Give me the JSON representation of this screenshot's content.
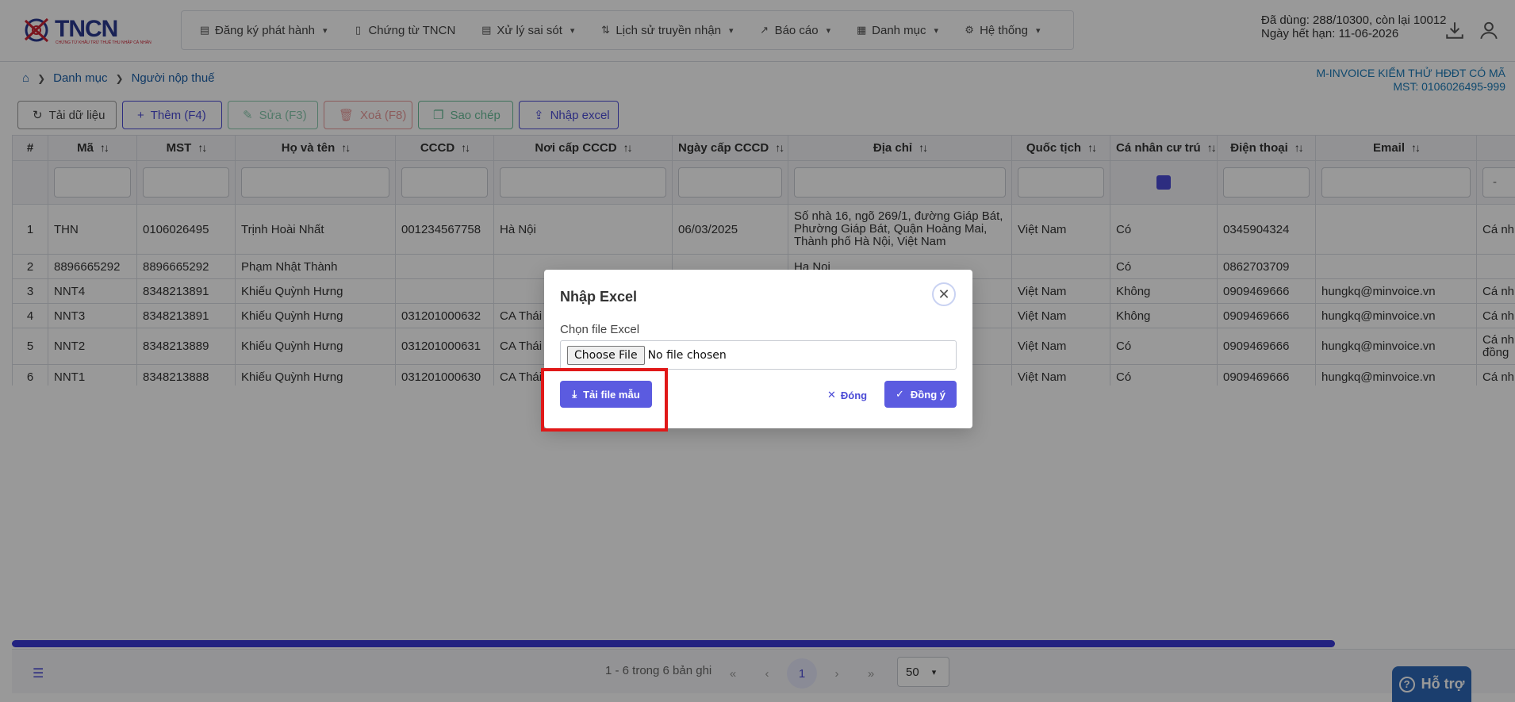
{
  "header": {
    "logo_text": "TNCN",
    "logo_sub": "CHỨNG TỪ KHẤU TRỪ THUẾ THU NHẬP CÁ NHÂN",
    "menu": [
      {
        "label": "Đăng ký phát hành",
        "icon": "file-edit-icon"
      },
      {
        "label": "Chứng từ TNCN",
        "icon": "document-icon"
      },
      {
        "label": "Xử lý sai sót",
        "icon": "file-warning-icon"
      },
      {
        "label": "Lịch sử truyền nhận",
        "icon": "transfer-icon"
      },
      {
        "label": "Báo cáo",
        "icon": "chart-icon"
      },
      {
        "label": "Danh mục",
        "icon": "grid-icon"
      },
      {
        "label": "Hệ thống",
        "icon": "gear-icon"
      }
    ],
    "quota_used": "Đã dùng: 288/10300, còn lại 10012",
    "quota_expiry": "Ngày hết hạn: 11-06-2026"
  },
  "breadcrumb": [
    "Danh mục",
    "Người nộp thuế"
  ],
  "company": {
    "name": "M-INVOICE KIỂM THỬ HĐĐT CÓ MÃ",
    "tax_code": "MST: 0106026495-999"
  },
  "toolbar": {
    "reload": "Tải dữ liệu",
    "add": "Thêm (F4)",
    "edit": "Sửa (F3)",
    "delete": "Xoá (F8)",
    "copy": "Sao chép",
    "import": "Nhập excel"
  },
  "table": {
    "columns": [
      "#",
      "Mã",
      "MST",
      "Họ và tên",
      "CCCD",
      "Nơi cấp CCCD",
      "Ngày cấp CCCD",
      "Địa chỉ",
      "Quốc tịch",
      "Cá nhân cư trú",
      "Điện thoại",
      "Email",
      ""
    ],
    "rows": [
      [
        "1",
        "THN",
        "0106026495",
        "Trịnh Hoài Nhất",
        "001234567758",
        "Hà Nội",
        "06/03/2025",
        "Số nhà 16, ngõ 269/1, đường Giáp Bát, Phường Giáp Bát, Quận Hoàng Mai, Thành phố Hà Nội, Việt Nam",
        "Việt Nam",
        "Có",
        "0345904324",
        "",
        "Cá nh"
      ],
      [
        "2",
        "8896665292",
        "8896665292",
        "Phạm Nhật Thành",
        "",
        "",
        "",
        "Ha Noi",
        "",
        "Có",
        "0862703709",
        "",
        ""
      ],
      [
        "3",
        "NNT4",
        "8348213891",
        "Khiếu Quỳnh Hưng",
        "",
        "",
        "",
        "",
        "Việt Nam",
        "Không",
        "0909469666",
        "hungkq@minvoice.vn",
        "Cá nh"
      ],
      [
        "4",
        "NNT3",
        "8348213891",
        "Khiếu Quỳnh Hưng",
        "031201000632",
        "CA Thái B",
        "",
        "",
        "Việt Nam",
        "Không",
        "0909469666",
        "hungkq@minvoice.vn",
        "Cá nh"
      ],
      [
        "5",
        "NNT2",
        "8348213889",
        "Khiếu Quỳnh Hưng",
        "031201000631",
        "CA Thái B",
        "",
        "",
        "Việt Nam",
        "Có",
        "0909469666",
        "hungkq@minvoice.vn",
        "Cá nh đồng"
      ],
      [
        "6",
        "NNT1",
        "8348213888",
        "Khiếu Quỳnh Hưng",
        "031201000630",
        "CA Thái B",
        "",
        "",
        "Việt Nam",
        "Có",
        "0909469666",
        "hungkq@minvoice.vn",
        "Cá nh"
      ]
    ],
    "last_filter_value": "-"
  },
  "pagination": {
    "info": "1 - 6 trong 6 bản ghi",
    "current": "1",
    "page_size": "50"
  },
  "help": {
    "label": "Hỗ trợ"
  },
  "modal": {
    "title": "Nhập Excel",
    "file_label": "Chọn file Excel",
    "file_button": "Choose File",
    "file_status": "No file chosen",
    "download_template": "Tải file mẫu",
    "close": "Đóng",
    "confirm": "Đồng ý"
  },
  "colors": {
    "primary": "#5b5be0",
    "link": "#1a5fa8",
    "highlight": "#e01818"
  }
}
